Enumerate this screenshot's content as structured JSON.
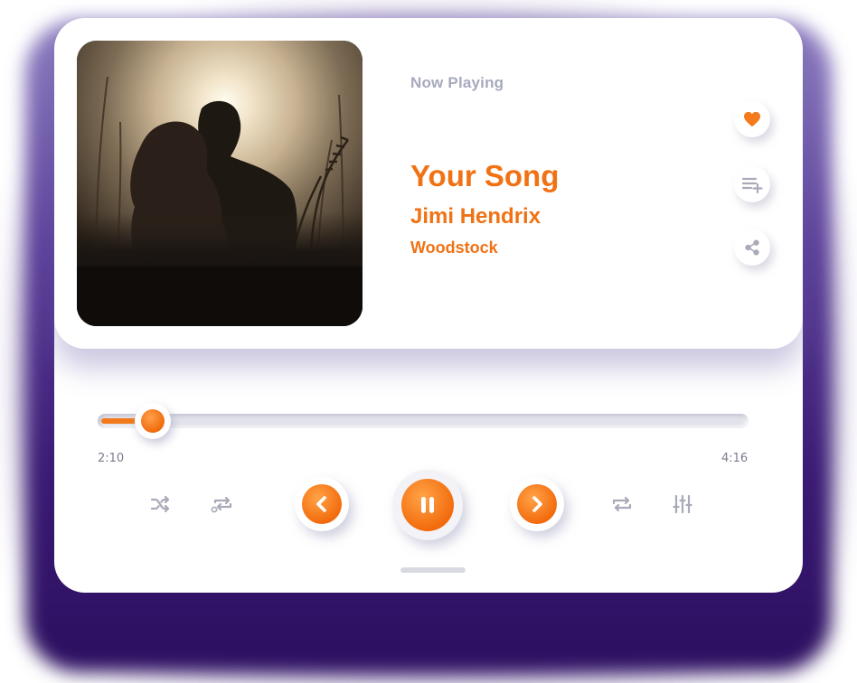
{
  "player": {
    "now_playing_label": "Now Playing",
    "song_title": "Your Song",
    "artist": "Jimi Hendrix",
    "album": "Woodstock",
    "album_art_icon": "album-cover-couple-silhouette"
  },
  "actions": {
    "like_icon": "heart-icon",
    "queue_icon": "playlist-add-icon",
    "share_icon": "share-icon"
  },
  "progress": {
    "elapsed": "2:10",
    "total": "4:16",
    "fraction": 0.08
  },
  "controls": {
    "shuffle_icon": "shuffle-icon",
    "repeat_one_icon": "repeat-one-icon",
    "previous_icon": "chevron-left-icon",
    "play_pause_icon": "pause-icon",
    "next_icon": "chevron-right-icon",
    "repeat_icon": "repeat-icon",
    "equalizer_icon": "equalizer-icon"
  },
  "colors": {
    "accent": "#f07214",
    "muted_text": "#a7a9bd",
    "icon_gray": "#a8aab8",
    "frame_purple": "#3a1a73"
  }
}
